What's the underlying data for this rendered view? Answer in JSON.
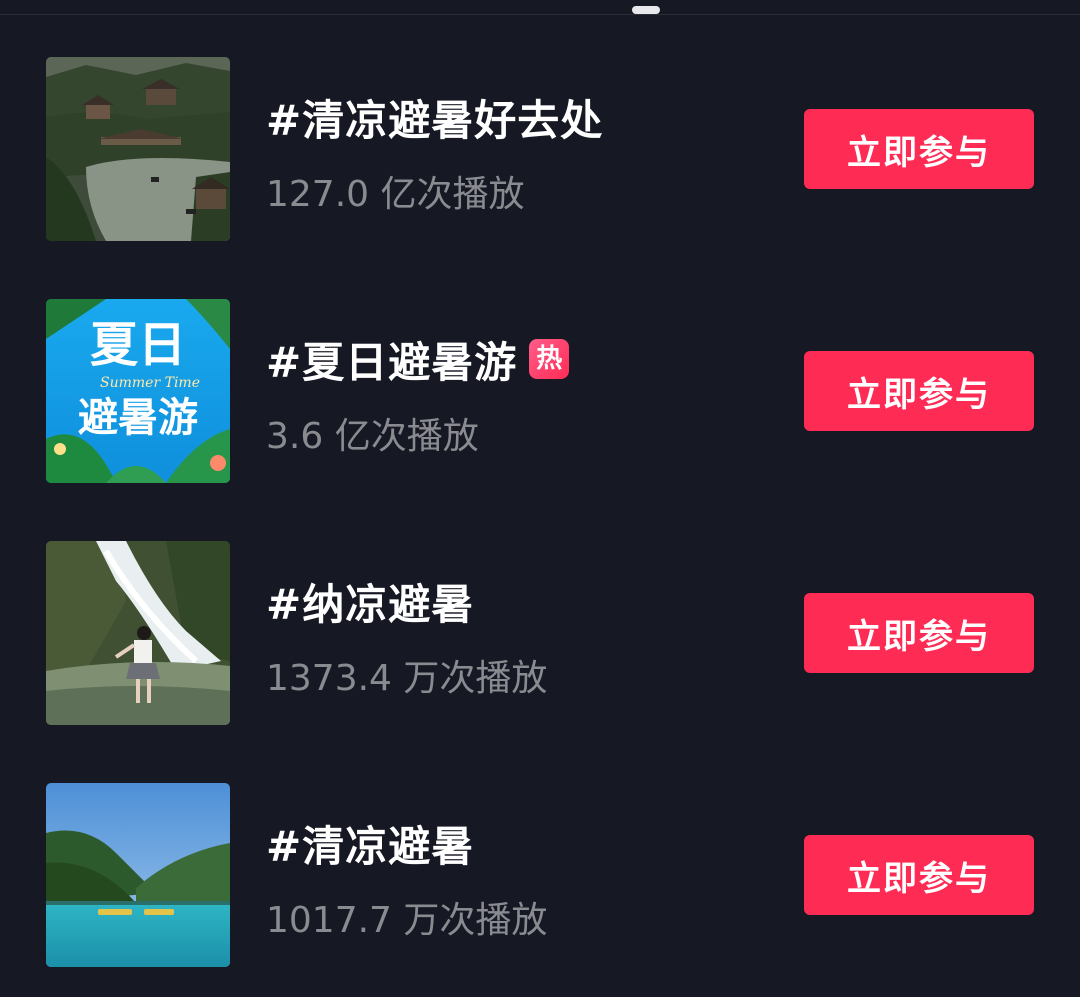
{
  "topics": [
    {
      "title": "#清凉避暑好去处",
      "plays": "127.0 亿次播放",
      "hot": "",
      "thumbnail": "village-river-thumbnail",
      "join_label": "立即参与"
    },
    {
      "title": "#夏日避暑游",
      "plays": "3.6 亿次播放",
      "hot": "热",
      "thumbnail": "summer-trip-poster-thumbnail",
      "thumb_text": {
        "line1": "夏日",
        "line2": "避暑游",
        "english": "Summer Time"
      },
      "join_label": "立即参与"
    },
    {
      "title": "#纳凉避暑",
      "plays": "1373.4 万次播放",
      "hot": "",
      "thumbnail": "waterfall-girl-thumbnail",
      "join_label": "立即参与"
    },
    {
      "title": "#清凉避暑",
      "plays": "1017.7 万次播放",
      "hot": "",
      "thumbnail": "mountain-lake-thumbnail",
      "join_label": "立即参与"
    }
  ],
  "colors": {
    "background": "#161823",
    "accent": "#fe2c55",
    "secondary_text": "#8a8b91"
  }
}
